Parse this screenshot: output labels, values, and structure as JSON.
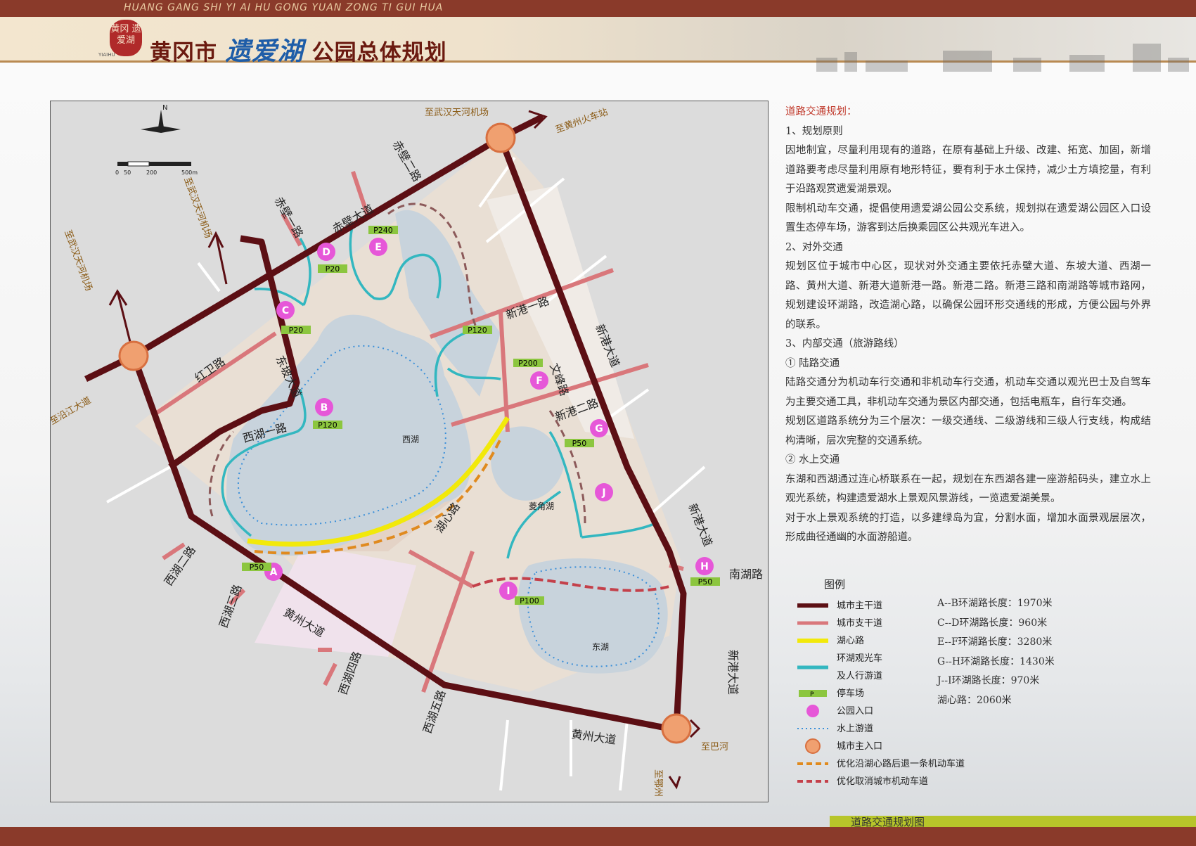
{
  "header": {
    "pinyin": "HUANG GANG SHI YI AI HU GONG YUAN ZONG TI GUI HUA",
    "seal_text": "黄冈 遗爱湖",
    "seal_sub": "YIAIHU",
    "title_prefix": "黄冈市",
    "title_brand": "遗爱湖",
    "title_suffix": "公园总体规划"
  },
  "footer": {
    "sheet_title": "道路交通规划图"
  },
  "map": {
    "scale": {
      "ticks": [
        "0",
        "50",
        "200",
        "500m"
      ],
      "north": "N"
    },
    "external_labels": [
      "至武汉天河机场",
      "至黄州火车站",
      "至武汉天河机场",
      "至武汉天河机场",
      "至沿江大道",
      "至巴河",
      "至鄂州"
    ],
    "road_labels": {
      "chibi_road": "赤壁大道",
      "chibi_1": "赤壁一路",
      "chibi_2": "赤壁二路",
      "dongpo": "东坡大道",
      "hongwei": "红卫路",
      "xihu_1": "西湖一路",
      "xihu_2": "西湖二路",
      "xihu_3": "西湖三路",
      "xihu_4": "西湖四路",
      "xihu_5": "西湖五路",
      "huangzhou_1": "黄州大道",
      "huangzhou_2": "黄州大道",
      "xingang_1": "新港一路",
      "xingang_2": "新港二路",
      "xingang_dadao_1": "新港大道",
      "xingang_dadao_2": "新港大道",
      "xingang_dadao_3": "新港大道",
      "wenfeng": "文峰路",
      "nanhu": "南湖路",
      "huxin": "湖心路"
    },
    "water_labels": {
      "west": "西湖",
      "east": "东湖",
      "lingjiao": "菱角湖"
    },
    "entrances": [
      "A",
      "B",
      "C",
      "D",
      "E",
      "F",
      "G",
      "H",
      "I",
      "J"
    ],
    "parking": [
      "P240",
      "P20",
      "P20",
      "P120",
      "P120",
      "P200",
      "P50",
      "P50",
      "P50",
      "P100"
    ]
  },
  "description": {
    "heading": "道路交通规划：",
    "s1_title": "1、规划原则",
    "s1_p1": "因地制宜，尽量利用现有的道路，在原有基础上升级、改建、拓宽、加固，新增道路要考虑尽量利用原有地形特征，要有利于水土保持，减少土方填挖量，有利于沿路观赏遗爱湖景观。",
    "s1_p2": "限制机动车交通，提倡使用遗爱湖公园公交系统，规划拟在遗爱湖公园区入口设置生态停车场，游客到达后换乘园区公共观光车进入。",
    "s2_title": "2、对外交通",
    "s2_p1": "规划区位于城市中心区，现状对外交通主要依托赤壁大道、东坡大道、西湖一路、黄州大道、新港大道新港一路。新港二路。新港三路和南湖路等城市路网，规划建设环湖路，改造湖心路，以确保公园环形交通线的形成，方便公园与外界的联系。",
    "s3_title": "3、内部交通（旅游路线）",
    "s3_a": "① 陆路交通",
    "s3_p1": "陆路交通分为机动车行交通和非机动车行交通，机动车交通以观光巴士及自驾车为主要交通工具，非机动车交通为景区内部交通，包括电瓶车，自行车交通。",
    "s3_p2": "规划区道路系统分为三个层次：一级交通线、二级游线和三级人行支线，构成结构清晰，层次完整的交通系统。",
    "s3_b": "② 水上交通",
    "s3_p3": "东湖和西湖通过连心桥联系在一起，规划在东西湖各建一座游船码头，建立水上观光系统，构建遗爱湖水上景观风景游线，一览遗爱湖美景。",
    "s3_p4": "对于水上景观系统的打造，以多建绿岛为宜，分割水面，增加水面景观层层次，形成曲径通幽的水面游船道。"
  },
  "legend": {
    "title": "图例",
    "items": [
      {
        "label": "城市主干道",
        "icon": "dark-line",
        "color": "#5c0f14"
      },
      {
        "label": "城市支干道",
        "icon": "pink-line",
        "color": "#d9777b"
      },
      {
        "label": "湖心路",
        "icon": "yellow-line",
        "color": "#f2e90a"
      },
      {
        "label": "环湖观光车",
        "icon": "teal-line",
        "color": "#33b7c0"
      },
      {
        "label": "及人行游道",
        "icon": "",
        "color": ""
      },
      {
        "label": "停车场",
        "icon": "parking-tag",
        "color": "#8cc63f"
      },
      {
        "label": "公园入口",
        "icon": "entrance-dot",
        "color": "#e657d8"
      },
      {
        "label": "水上游道",
        "icon": "dotted-line",
        "color": "#3a8fd9"
      },
      {
        "label": "城市主入口",
        "icon": "main-entrance-icon",
        "color": "#f0a070"
      },
      {
        "label": "优化沿湖心路后退一条机动车道",
        "icon": "orange-dashed-line",
        "color": "#e08a1e"
      },
      {
        "label": "优化取消城市机动车道",
        "icon": "red-dashed-line",
        "color": "#c4404a"
      }
    ],
    "parking_letter": "P"
  },
  "lengths": [
    "A--B环湖路长度：1970米",
    "C--D环湖路长度：960米",
    "E--F环湖路长度：3280米",
    "G--H环湖路长度：1430米",
    "J--I环湖路长度：970米",
    "湖心路：2060米"
  ]
}
